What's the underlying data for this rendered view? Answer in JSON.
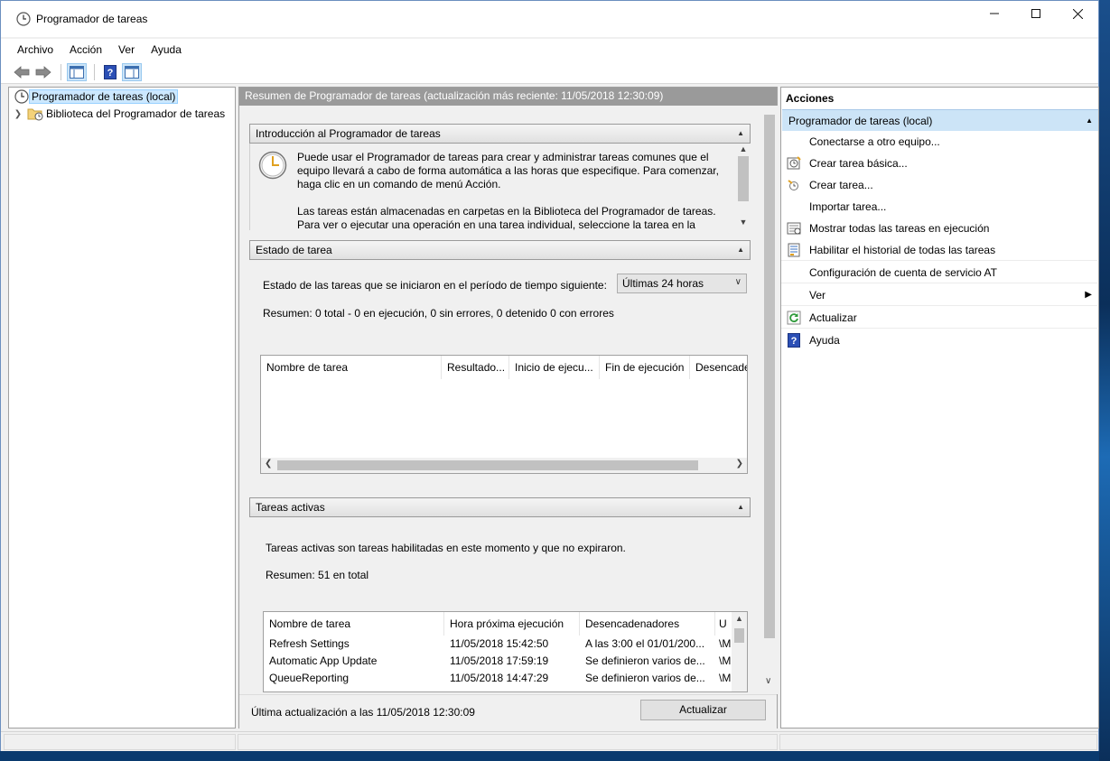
{
  "window": {
    "title": "Programador de tareas"
  },
  "menu": [
    "Archivo",
    "Acción",
    "Ver",
    "Ayuda"
  ],
  "tree": {
    "root": "Programador de tareas (local)",
    "child": "Biblioteca del Programador de tareas"
  },
  "center": {
    "header": "Resumen de Programador de tareas (actualización más reciente: 11/05/2018 12:30:09)",
    "intro": {
      "title": "Introducción al Programador de tareas",
      "p1": "Puede usar el Programador de tareas para crear y administrar tareas comunes que el equipo llevará a cabo de forma automática a las horas que especifique. Para comenzar, haga clic en un comando de menú Acción.",
      "p2": "Las tareas están almacenadas en carpetas en la Biblioteca del Programador de tareas. Para ver o ejecutar una operación en una tarea individual, seleccione la tarea en la"
    },
    "status": {
      "title": "Estado de tarea",
      "period_label": "Estado de las tareas que se iniciaron en el período de tiempo siguiente:",
      "period_value": "Últimas 24 horas",
      "summary": "Resumen: 0 total - 0 en ejecución, 0 sin errores, 0 detenido  0 con errores",
      "columns": [
        "Nombre de tarea",
        "Resultado...",
        "Inicio de ejecu...",
        "Fin de ejecución",
        "Desencade"
      ]
    },
    "active": {
      "title": "Tareas activas",
      "description": "Tareas activas son tareas habilitadas en este momento y que no expiraron.",
      "summary": "Resumen: 51 en total",
      "columns": [
        "Nombre de tarea",
        "Hora próxima ejecución",
        "Desencadenadores",
        "U"
      ],
      "rows": [
        [
          "Refresh Settings",
          "11/05/2018 15:42:50",
          "A las 3:00 el 01/01/200...",
          "\\M"
        ],
        [
          "Automatic App Update",
          "11/05/2018 17:59:19",
          "Se definieron varios de...",
          "\\M"
        ],
        [
          "QueueReporting",
          "11/05/2018 14:47:29",
          "Se definieron varios de...",
          "\\M"
        ]
      ]
    },
    "footer": {
      "last_update": "Última actualización a las 11/05/2018 12:30:09",
      "refresh": "Actualizar"
    }
  },
  "actions": {
    "title": "Acciones",
    "group": "Programador de tareas (local)",
    "items": [
      {
        "label": "Conectarse a otro equipo...",
        "icon": "none"
      },
      {
        "label": "Crear tarea básica...",
        "icon": "create-basic-task-icon"
      },
      {
        "label": "Crear tarea...",
        "icon": "create-task-icon"
      },
      {
        "label": "Importar tarea...",
        "icon": "none"
      },
      {
        "label": "Mostrar todas las tareas en ejecución",
        "icon": "running-tasks-icon"
      },
      {
        "label": "Habilitar el historial de todas las tareas",
        "icon": "history-icon"
      },
      {
        "label": "Configuración de cuenta de servicio AT",
        "icon": "none"
      },
      {
        "label": "Ver",
        "icon": "none"
      },
      {
        "label": "Actualizar",
        "icon": "refresh-icon"
      },
      {
        "label": "Ayuda",
        "icon": "help-icon"
      }
    ]
  }
}
